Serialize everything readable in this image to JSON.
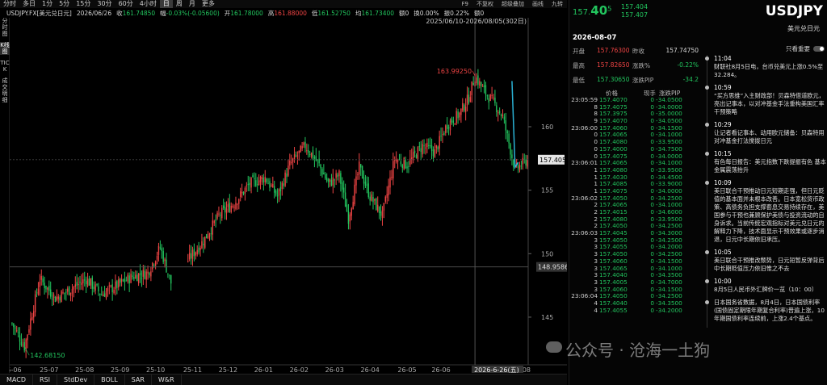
{
  "toolbar": {
    "timeframes": [
      "分时",
      "多日",
      "1分",
      "5分",
      "15分",
      "30分",
      "60分",
      "4小时",
      "日",
      "周",
      "月",
      "更多"
    ],
    "active": "日",
    "right": [
      "F9",
      "不复权",
      "超级叠加",
      "画线",
      "九转"
    ]
  },
  "quote": {
    "symbol": "USDJPY.FX[美元兑日元]",
    "date": "2026/06/26",
    "close_label": "收",
    "close": "161.74850",
    "change_label": "幅",
    "change": "-0.03%(-0.05600)",
    "open_label": "开",
    "open": "161.78000",
    "high_label": "高",
    "high": "161.88000",
    "low_label": "低",
    "low": "161.52750",
    "avg_label": "均",
    "avg": "161.73400",
    "amount_label": "额",
    "amount": "0",
    "turnover_label": "换",
    "turnover": "0.00%",
    "swing_label": "振",
    "swing": "0.22%",
    "amount_unit": "额",
    "amount2": "0"
  },
  "left_strip": [
    "分时图",
    "K线图",
    "TICK",
    "成交明细"
  ],
  "bottom_tabs": [
    "MACD",
    "RSI",
    "StdDev",
    "BOLL",
    "SAR",
    "W&R"
  ],
  "chart_data": {
    "type": "candlestick",
    "period": "2025/06/10-2026/08/05(302日)",
    "x_ticks": [
      "25-06",
      "25-07",
      "25-08",
      "25-09",
      "25-10",
      "25-11",
      "25-12",
      "26-01",
      "26-02",
      "26-03",
      "26-04",
      "26-05",
      "26-06",
      "26-08"
    ],
    "y_ticks": [
      145,
      150,
      155,
      160
    ],
    "ylim": [
      141.5,
      168.2
    ],
    "max_label": "163.99250",
    "min_label": "142.68150",
    "last_price": "157.405",
    "crosshair_price": "148.9586",
    "crosshair_date": "2026-6-26(五)",
    "anchors": [
      [
        0,
        144.5
      ],
      [
        8,
        142.68
      ],
      [
        18,
        148.0
      ],
      [
        28,
        146.5
      ],
      [
        38,
        147.2
      ],
      [
        48,
        148.0
      ],
      [
        58,
        146.8
      ],
      [
        68,
        147.5
      ],
      [
        78,
        148.2
      ],
      [
        88,
        148.5
      ],
      [
        96,
        150.5
      ],
      [
        104,
        147.3
      ],
      [
        114,
        149.5
      ],
      [
        124,
        151.0
      ],
      [
        134,
        153.0
      ],
      [
        144,
        154.0
      ],
      [
        154,
        155.5
      ],
      [
        164,
        156.0
      ],
      [
        172,
        154.5
      ],
      [
        180,
        157.0
      ],
      [
        190,
        158.5
      ],
      [
        198,
        157.2
      ],
      [
        205,
        155.5
      ],
      [
        212,
        156.2
      ],
      [
        218,
        152.8
      ],
      [
        225,
        156.8
      ],
      [
        232,
        154.5
      ],
      [
        240,
        153.0
      ],
      [
        248,
        157.5
      ],
      [
        256,
        157.0
      ],
      [
        266,
        158.5
      ],
      [
        274,
        158.0
      ],
      [
        282,
        160.2
      ],
      [
        290,
        161.0
      ],
      [
        296,
        162.3
      ],
      [
        300,
        163.99
      ],
      [
        306,
        162.8
      ],
      [
        312,
        161.9
      ],
      [
        318,
        160.8
      ],
      [
        326,
        156.6
      ],
      [
        334,
        157.4
      ]
    ],
    "gap": [
      104,
      114
    ]
  },
  "right_panel": {
    "price_main": "157.",
    "price_big": "40",
    "price_sup": "5",
    "bid": "157.404",
    "ask": "157.407",
    "symbol": "USDJPY",
    "symbol_cn": "美元兑日元",
    "date": "2026-08-07",
    "stats": [
      {
        "k1": "开盘",
        "v1": "157.76300",
        "c1": "r",
        "k2": "昨收",
        "v2": "157.74750",
        "c2": "w"
      },
      {
        "k1": "最高",
        "v1": "157.82650",
        "c1": "r",
        "k2": "涨跌%",
        "v2": "-0.22%",
        "c2": "g"
      },
      {
        "k1": "最低",
        "v1": "157.30650",
        "c1": "g",
        "k2": "涨跌PIP",
        "v2": "-34.2",
        "c2": "g"
      }
    ],
    "ticks_head": {
      "price": "价格",
      "vol": "现手",
      "chg": "涨跌PIP"
    },
    "ticks": [
      {
        "t": "23:05:59",
        "p": "157.4070",
        "v": "0",
        "c": "-34.0500"
      },
      {
        "t": "8",
        "p": "157.4075",
        "v": "0",
        "c": "-34.0000"
      },
      {
        "t": "8",
        "p": "157.3975",
        "v": "0",
        "c": "-35.0000"
      },
      {
        "t": "9",
        "p": "157.4070",
        "v": "0",
        "c": "-34.0500"
      },
      {
        "t": "23:06:00",
        "p": "157.4060",
        "v": "0",
        "c": "-34.1500"
      },
      {
        "t": "0",
        "p": "157.4065",
        "v": "0",
        "c": "-34.1000"
      },
      {
        "t": "0",
        "p": "157.4080",
        "v": "0",
        "c": "-33.9500"
      },
      {
        "t": "0",
        "p": "157.4000",
        "v": "0",
        "c": "-34.7500"
      },
      {
        "t": "0",
        "p": "157.4075",
        "v": "0",
        "c": "-34.0000"
      },
      {
        "t": "23:06:01",
        "p": "157.4065",
        "v": "0",
        "c": "-34.1000"
      },
      {
        "t": "1",
        "p": "157.4080",
        "v": "0",
        "c": "-33.9500"
      },
      {
        "t": "1",
        "p": "157.4030",
        "v": "0",
        "c": "-34.4500"
      },
      {
        "t": "1",
        "p": "157.4085",
        "v": "0",
        "c": "-33.9000"
      },
      {
        "t": "1",
        "p": "157.4075",
        "v": "0",
        "c": "-34.0000"
      },
      {
        "t": "23:06:02",
        "p": "157.4050",
        "v": "0",
        "c": "-34.2500"
      },
      {
        "t": "2",
        "p": "157.4065",
        "v": "0",
        "c": "-34.1000"
      },
      {
        "t": "2",
        "p": "157.4015",
        "v": "0",
        "c": "-34.6000"
      },
      {
        "t": "2",
        "p": "157.4080",
        "v": "0",
        "c": "-33.9500"
      },
      {
        "t": "2",
        "p": "157.4050",
        "v": "0",
        "c": "-34.2500"
      },
      {
        "t": "23:06:03",
        "p": "157.4045",
        "v": "0",
        "c": "-34.3000"
      },
      {
        "t": "3",
        "p": "157.4050",
        "v": "0",
        "c": "-34.2500"
      },
      {
        "t": "3",
        "p": "157.4055",
        "v": "0",
        "c": "-34.2000"
      },
      {
        "t": "3",
        "p": "157.4050",
        "v": "0",
        "c": "-34.2500"
      },
      {
        "t": "3",
        "p": "157.4060",
        "v": "0",
        "c": "-34.1500"
      },
      {
        "t": "3",
        "p": "157.4065",
        "v": "0",
        "c": "-34.1000"
      },
      {
        "t": "3",
        "p": "157.4040",
        "v": "0",
        "c": "-34.3500"
      },
      {
        "t": "3",
        "p": "157.4005",
        "v": "0",
        "c": "-34.7000"
      },
      {
        "t": "3",
        "p": "157.4060",
        "v": "0",
        "c": "-34.1500"
      },
      {
        "t": "23:06:04",
        "p": "157.4050",
        "v": "0",
        "c": "-34.2500"
      },
      {
        "t": "4",
        "p": "157.4040",
        "v": "0",
        "c": "-34.3500"
      },
      {
        "t": "4",
        "p": "157.4055",
        "v": "0",
        "c": "-34.2000"
      }
    ],
    "news_toggle_label": "只看重要",
    "news": [
      {
        "time": "11:04",
        "text": "财联社8月5日电，台币兑美元上涨0.5%至32.284。"
      },
      {
        "time": "10:59",
        "text": "“买方思维”入主财政部！贝森特借道欧元，亮出记事本，以对冲基金手法重构美国汇率干预策略"
      },
      {
        "time": "10:29",
        "text": "让记者看记事本、动用欧元储备：贝森特用对冲基金打法搅拨日元"
      },
      {
        "time": "10:15",
        "text": "有色每日报告：美元指数下跌提振有色 基本金属震荡抬升"
      },
      {
        "time": "10:09",
        "text": "美日联合干预推动日元短期走强，但日元贬值的基本面并未根本改善。日本宽松货币政策、高债务负担支撑套息交易持续存在，美国参与干预也兼顾保护美债与投资流动的自身诉求。当前传统宏观指标对美元兑日元的解释力下降，技术面显示干预效果或逐步消退，日元中长期依旧承压。"
      },
      {
        "time": "10:05",
        "text": "美日联合干预推改颓势，日元短暂反弹背后中长期贬值压力依旧惟之不去"
      },
      {
        "time": "10:00",
        "text": "8月5日人民币外汇牌价一览（10：00）"
      },
      {
        "time": "",
        "text": "日本国务省数据，8月4日，日本国债利率(国债固定期限年期复合利率)普遍上涨，10年期国债利率连续前，上涨2.4个基点。"
      }
    ]
  },
  "watermark": "公众号 · 沧海一土狗",
  "colors": {
    "up": "#ef4444",
    "down": "#22c55e",
    "bg": "#000000",
    "price_line": "#2bb3d6"
  }
}
